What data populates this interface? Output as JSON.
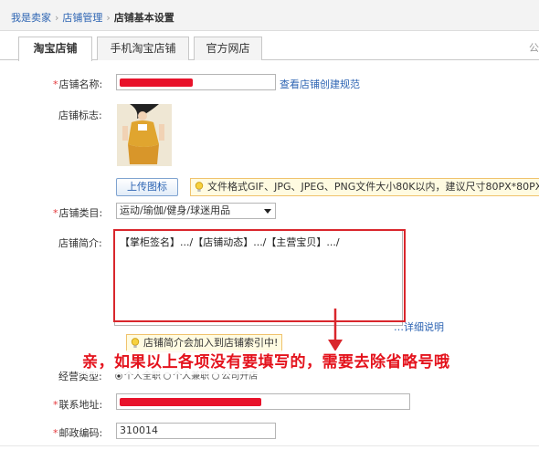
{
  "breadcrumb": {
    "items": [
      "我是卖家",
      "店铺管理"
    ],
    "current": "店铺基本设置",
    "separator": "›"
  },
  "tabs": [
    {
      "label": "淘宝店铺",
      "active": true
    },
    {
      "label": "手机淘宝店铺",
      "active": false
    },
    {
      "label": "官方网店",
      "active": false
    }
  ],
  "corner_text": "公",
  "form": {
    "shop_name": {
      "required_mark": "*",
      "label": "店铺名称:",
      "rule_link": "查看店铺创建规范"
    },
    "shop_logo": {
      "label": "店铺标志:",
      "upload_button": "上传图标",
      "tip": "文件格式GIF、JPG、JPEG、PNG文件大小80K以内，建议尺寸80PX*80PX"
    },
    "shop_category": {
      "required_mark": "*",
      "label": "店铺类目:",
      "selected": "运动/瑜伽/健身/球迷用品"
    },
    "shop_intro": {
      "label": "店铺简介:",
      "value": "【掌柜签名】.../【店铺动态】.../【主营宝贝】.../",
      "detail_link": "详细说明",
      "tip": "店铺简介会加入到店铺索引中!"
    },
    "business_type": {
      "label": "经营类型:",
      "options": [
        "个人全职",
        "个人兼职",
        "公司开店"
      ]
    },
    "address": {
      "required_mark": "*",
      "label": "联系地址:"
    },
    "postcode": {
      "required_mark": "*",
      "label": "邮政编码:",
      "value": "310014"
    }
  },
  "annotation": "亲，如果以上各项没有要填写的，需要去除省略号哦",
  "colors": {
    "accent": "#2d64b3",
    "annotation_red": "#e4131d",
    "tip_bg": "#fffbe1",
    "tip_border": "#f0c36d"
  }
}
